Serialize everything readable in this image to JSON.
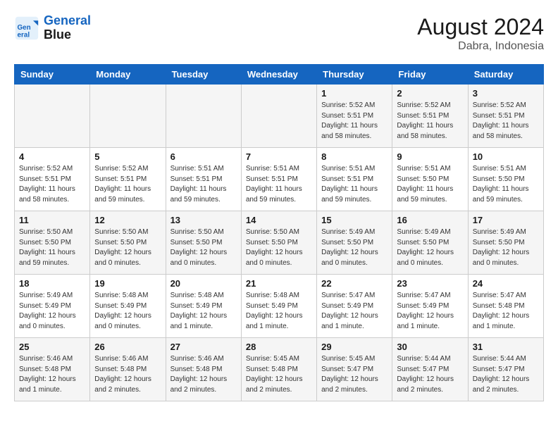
{
  "header": {
    "logo_line1": "General",
    "logo_line2": "Blue",
    "month_year": "August 2024",
    "location": "Dabra, Indonesia"
  },
  "weekdays": [
    "Sunday",
    "Monday",
    "Tuesday",
    "Wednesday",
    "Thursday",
    "Friday",
    "Saturday"
  ],
  "weeks": [
    [
      {
        "day": "",
        "info": ""
      },
      {
        "day": "",
        "info": ""
      },
      {
        "day": "",
        "info": ""
      },
      {
        "day": "",
        "info": ""
      },
      {
        "day": "1",
        "info": "Sunrise: 5:52 AM\nSunset: 5:51 PM\nDaylight: 11 hours\nand 58 minutes."
      },
      {
        "day": "2",
        "info": "Sunrise: 5:52 AM\nSunset: 5:51 PM\nDaylight: 11 hours\nand 58 minutes."
      },
      {
        "day": "3",
        "info": "Sunrise: 5:52 AM\nSunset: 5:51 PM\nDaylight: 11 hours\nand 58 minutes."
      }
    ],
    [
      {
        "day": "4",
        "info": "Sunrise: 5:52 AM\nSunset: 5:51 PM\nDaylight: 11 hours\nand 58 minutes."
      },
      {
        "day": "5",
        "info": "Sunrise: 5:52 AM\nSunset: 5:51 PM\nDaylight: 11 hours\nand 59 minutes."
      },
      {
        "day": "6",
        "info": "Sunrise: 5:51 AM\nSunset: 5:51 PM\nDaylight: 11 hours\nand 59 minutes."
      },
      {
        "day": "7",
        "info": "Sunrise: 5:51 AM\nSunset: 5:51 PM\nDaylight: 11 hours\nand 59 minutes."
      },
      {
        "day": "8",
        "info": "Sunrise: 5:51 AM\nSunset: 5:51 PM\nDaylight: 11 hours\nand 59 minutes."
      },
      {
        "day": "9",
        "info": "Sunrise: 5:51 AM\nSunset: 5:50 PM\nDaylight: 11 hours\nand 59 minutes."
      },
      {
        "day": "10",
        "info": "Sunrise: 5:51 AM\nSunset: 5:50 PM\nDaylight: 11 hours\nand 59 minutes."
      }
    ],
    [
      {
        "day": "11",
        "info": "Sunrise: 5:50 AM\nSunset: 5:50 PM\nDaylight: 11 hours\nand 59 minutes."
      },
      {
        "day": "12",
        "info": "Sunrise: 5:50 AM\nSunset: 5:50 PM\nDaylight: 12 hours\nand 0 minutes."
      },
      {
        "day": "13",
        "info": "Sunrise: 5:50 AM\nSunset: 5:50 PM\nDaylight: 12 hours\nand 0 minutes."
      },
      {
        "day": "14",
        "info": "Sunrise: 5:50 AM\nSunset: 5:50 PM\nDaylight: 12 hours\nand 0 minutes."
      },
      {
        "day": "15",
        "info": "Sunrise: 5:49 AM\nSunset: 5:50 PM\nDaylight: 12 hours\nand 0 minutes."
      },
      {
        "day": "16",
        "info": "Sunrise: 5:49 AM\nSunset: 5:50 PM\nDaylight: 12 hours\nand 0 minutes."
      },
      {
        "day": "17",
        "info": "Sunrise: 5:49 AM\nSunset: 5:50 PM\nDaylight: 12 hours\nand 0 minutes."
      }
    ],
    [
      {
        "day": "18",
        "info": "Sunrise: 5:49 AM\nSunset: 5:49 PM\nDaylight: 12 hours\nand 0 minutes."
      },
      {
        "day": "19",
        "info": "Sunrise: 5:48 AM\nSunset: 5:49 PM\nDaylight: 12 hours\nand 0 minutes."
      },
      {
        "day": "20",
        "info": "Sunrise: 5:48 AM\nSunset: 5:49 PM\nDaylight: 12 hours\nand 1 minute."
      },
      {
        "day": "21",
        "info": "Sunrise: 5:48 AM\nSunset: 5:49 PM\nDaylight: 12 hours\nand 1 minute."
      },
      {
        "day": "22",
        "info": "Sunrise: 5:47 AM\nSunset: 5:49 PM\nDaylight: 12 hours\nand 1 minute."
      },
      {
        "day": "23",
        "info": "Sunrise: 5:47 AM\nSunset: 5:49 PM\nDaylight: 12 hours\nand 1 minute."
      },
      {
        "day": "24",
        "info": "Sunrise: 5:47 AM\nSunset: 5:48 PM\nDaylight: 12 hours\nand 1 minute."
      }
    ],
    [
      {
        "day": "25",
        "info": "Sunrise: 5:46 AM\nSunset: 5:48 PM\nDaylight: 12 hours\nand 1 minute."
      },
      {
        "day": "26",
        "info": "Sunrise: 5:46 AM\nSunset: 5:48 PM\nDaylight: 12 hours\nand 2 minutes."
      },
      {
        "day": "27",
        "info": "Sunrise: 5:46 AM\nSunset: 5:48 PM\nDaylight: 12 hours\nand 2 minutes."
      },
      {
        "day": "28",
        "info": "Sunrise: 5:45 AM\nSunset: 5:48 PM\nDaylight: 12 hours\nand 2 minutes."
      },
      {
        "day": "29",
        "info": "Sunrise: 5:45 AM\nSunset: 5:47 PM\nDaylight: 12 hours\nand 2 minutes."
      },
      {
        "day": "30",
        "info": "Sunrise: 5:44 AM\nSunset: 5:47 PM\nDaylight: 12 hours\nand 2 minutes."
      },
      {
        "day": "31",
        "info": "Sunrise: 5:44 AM\nSunset: 5:47 PM\nDaylight: 12 hours\nand 2 minutes."
      }
    ]
  ]
}
